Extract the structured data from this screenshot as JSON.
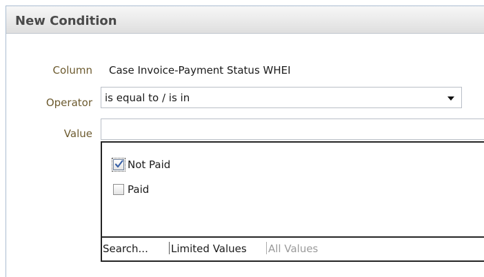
{
  "dialog": {
    "title": "New Condition"
  },
  "form": {
    "column_label": "Column",
    "column_value": "Case Invoice-Payment Status WHEI",
    "operator_label": "Operator",
    "operator_value": "is equal to / is in",
    "value_label": "Value",
    "value_input": ""
  },
  "options": [
    {
      "label": "Not Paid",
      "checked": true
    },
    {
      "label": "Paid",
      "checked": false
    }
  ],
  "footer": {
    "search": "Search...",
    "limited": "Limited Values",
    "all": "All Values"
  },
  "icons": {
    "operator_dropdown": "chevron-down-icon",
    "checkbox_checked": "checkmark-icon"
  },
  "colors": {
    "label_text": "#6c5a2e",
    "title_text": "#4a4a4a",
    "check_mark": "#3a62a8"
  }
}
